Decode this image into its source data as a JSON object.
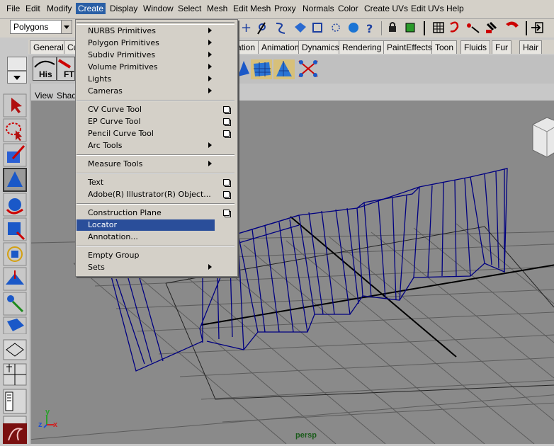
{
  "menubar": {
    "items": [
      "File",
      "Edit",
      "Modify",
      "Create",
      "Display",
      "Window",
      "Select",
      "Mesh",
      "Edit Mesh",
      "Proxy",
      "Normals",
      "Color",
      "Create UVs",
      "Edit UVs",
      "Help"
    ],
    "active": "Create"
  },
  "status": {
    "mode_value": "Polygons"
  },
  "shelf_tabs": [
    "General",
    "Cu",
    "ation",
    "Animation",
    "Dynamics",
    "Rendering",
    "PaintEffects",
    "Toon",
    "Fluids",
    "Fur",
    "Hair"
  ],
  "shelf": {
    "his_label": "His",
    "ft_label": "FT"
  },
  "viewport": {
    "menu": [
      "View",
      "Shad"
    ],
    "camera_label": "persp",
    "axis_x": "x",
    "axis_y": "y",
    "axis_z": "z"
  },
  "create_menu": {
    "items": [
      {
        "label": "NURBS Primitives",
        "kind": "submenu"
      },
      {
        "label": "Polygon Primitives",
        "kind": "submenu"
      },
      {
        "label": "Subdiv Primitives",
        "kind": "submenu"
      },
      {
        "label": "Volume Primitives",
        "kind": "submenu"
      },
      {
        "label": "Lights",
        "kind": "submenu"
      },
      {
        "label": "Cameras",
        "kind": "submenu"
      },
      {
        "label": "CV Curve Tool",
        "kind": "option"
      },
      {
        "label": "EP Curve Tool",
        "kind": "option"
      },
      {
        "label": "Pencil Curve Tool",
        "kind": "option"
      },
      {
        "label": "Arc Tools",
        "kind": "submenu"
      },
      {
        "label": "Measure Tools",
        "kind": "submenu"
      },
      {
        "label": "Text",
        "kind": "option"
      },
      {
        "label": "Adobe(R) Illustrator(R) Object...",
        "kind": "option"
      },
      {
        "label": "Construction Plane",
        "kind": "option"
      },
      {
        "label": "Locator",
        "kind": "plain"
      },
      {
        "label": "Annotation...",
        "kind": "plain"
      },
      {
        "label": "Empty Group",
        "kind": "plain"
      },
      {
        "label": "Sets",
        "kind": "submenu"
      }
    ],
    "highlighted": "Locator"
  },
  "colors": {
    "menu_highlight": "#2a4e9a",
    "wireframe": "#000080",
    "grid": "#5a5a5a"
  }
}
